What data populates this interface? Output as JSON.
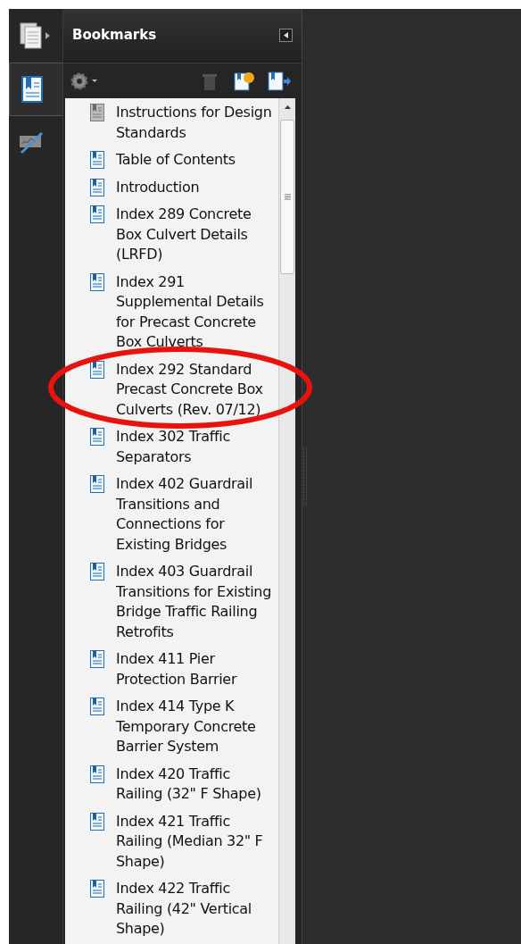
{
  "panel": {
    "title": "Bookmarks"
  },
  "bookmarks": [
    {
      "kind": "plain",
      "label": "Instructions for Design Standards"
    },
    {
      "kind": "page",
      "label": "Table of Contents"
    },
    {
      "kind": "page",
      "label": "Introduction"
    },
    {
      "kind": "page",
      "label": "Index 289 Concrete Box Culvert Details (LRFD)"
    },
    {
      "kind": "page",
      "label": "Index 291 Supplemental Details for Precast Concrete Box Culverts"
    },
    {
      "kind": "page",
      "label": "Index 292 Standard Precast Concrete Box Culverts (Rev. 07/12)"
    },
    {
      "kind": "page",
      "label": "Index 302 Traffic Separators"
    },
    {
      "kind": "page",
      "label": "Index 402 Guardrail Transitions and Connections for Existing Bridges"
    },
    {
      "kind": "page",
      "label": "Index 403 Guardrail Transitions for Existing Bridge Traffic Railing Retrofits"
    },
    {
      "kind": "page",
      "label": "Index 411 Pier Protection Barrier"
    },
    {
      "kind": "page",
      "label": "Index 414 Type K Temporary Concrete Barrier System"
    },
    {
      "kind": "page",
      "label": "Index 420 Traffic Railing (32\" F Shape)"
    },
    {
      "kind": "page",
      "label": "Index 421 Traffic Railing (Median 32\" F Shape)"
    },
    {
      "kind": "page",
      "label": "Index 422 Traffic Railing (42\" Vertical Shape)"
    }
  ]
}
